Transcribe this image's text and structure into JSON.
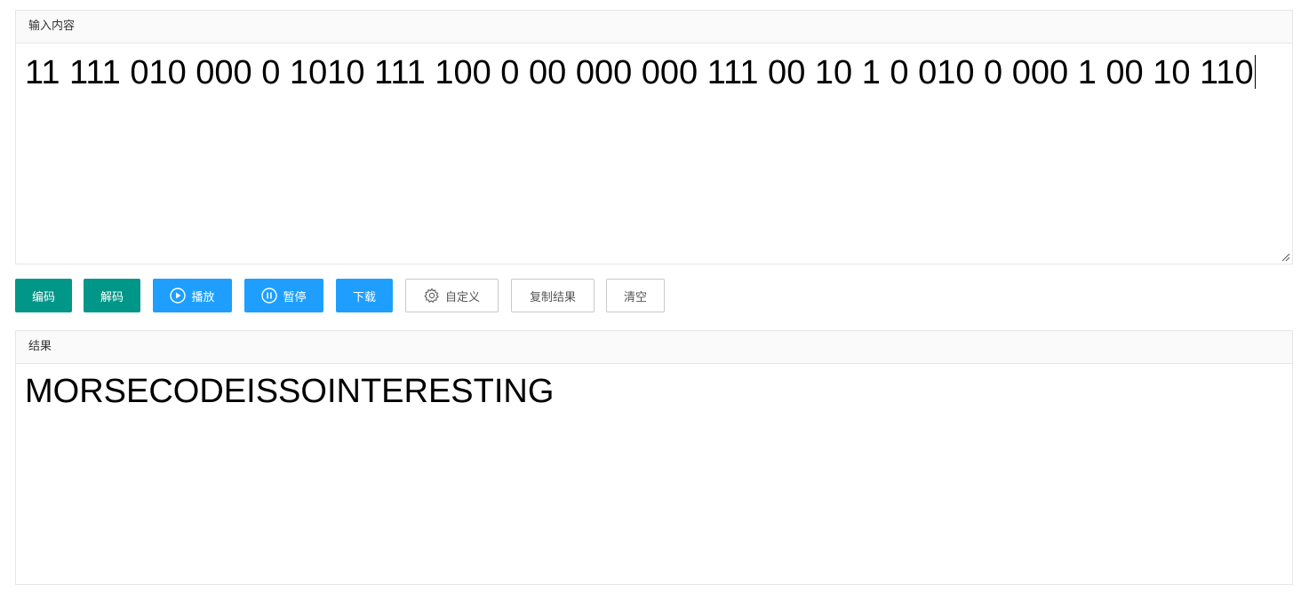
{
  "input_panel": {
    "header": "输入内容",
    "value": "11 111 010 000 0 1010 111 100 0 00 000 000 111 00 10 1 0 010 0 000 1 00 10 110"
  },
  "toolbar": {
    "encode_label": "编码",
    "decode_label": "解码",
    "play_label": "播放",
    "pause_label": "暂停",
    "download_label": "下载",
    "custom_label": "自定义",
    "copy_label": "复制结果",
    "clear_label": "清空"
  },
  "result_panel": {
    "header": "结果",
    "value": "MORSECODEISSOINTERESTING"
  },
  "icons": {
    "play": "play-circle-icon",
    "pause": "pause-circle-icon",
    "custom": "gear-icon"
  },
  "colors": {
    "green": "#009688",
    "blue": "#1e9fff",
    "border": "#e6e6e6"
  }
}
